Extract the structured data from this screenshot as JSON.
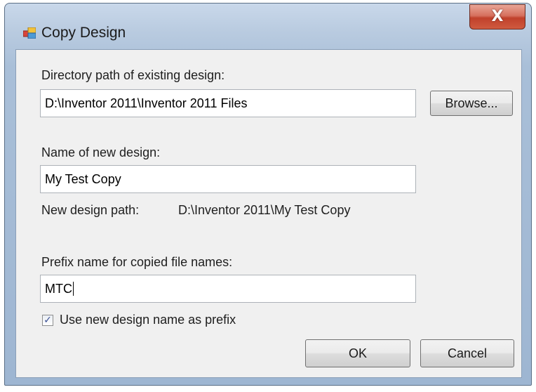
{
  "window": {
    "title": "Copy Design",
    "close_glyph": "X",
    "app_icon": "dialog-app-icon"
  },
  "existing": {
    "label": "Directory path of existing design:",
    "value": "D:\\Inventor 2011\\Inventor 2011 Files",
    "browse_label": "Browse..."
  },
  "new_design": {
    "label": "Name of new design:",
    "value": "My Test Copy",
    "path_label": "New design path:",
    "path_value": "D:\\Inventor 2011\\My Test Copy"
  },
  "prefix": {
    "label": "Prefix name for copied file names:",
    "value": "MTC"
  },
  "use_name_checkbox": {
    "label": "Use new design name as prefix",
    "checked": true
  },
  "buttons": {
    "ok": "OK",
    "cancel": "Cancel"
  },
  "colors": {
    "frame": "#b9cbe0",
    "client": "#f0f0f0",
    "close_button": "#c0412b"
  }
}
